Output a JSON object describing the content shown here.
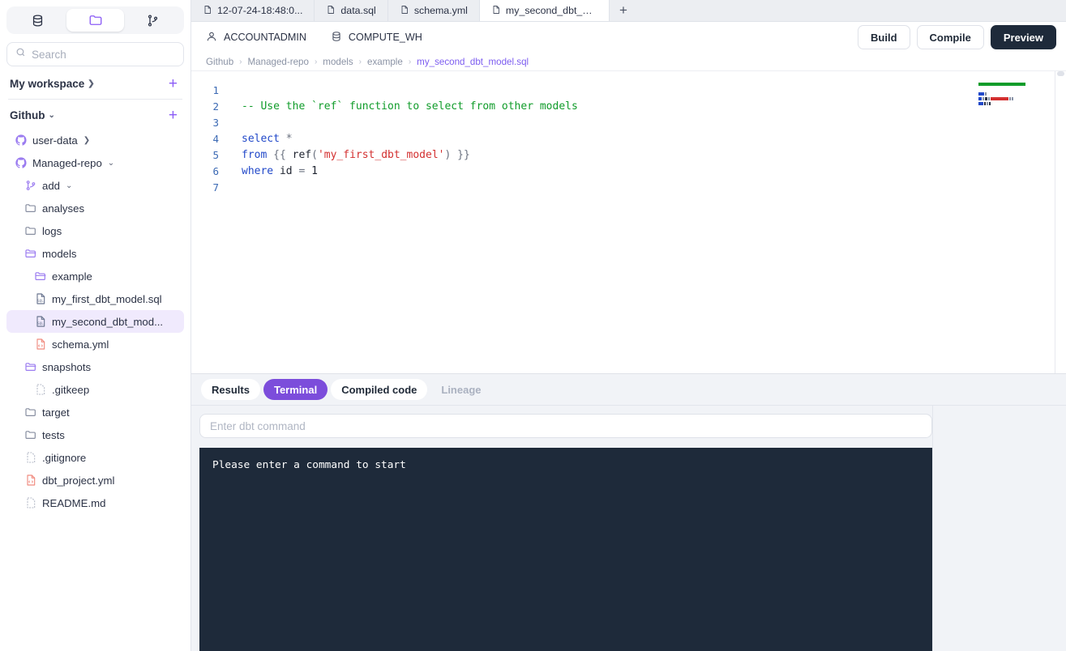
{
  "sidebar": {
    "segments": [
      {
        "name": "database-tab",
        "icon": "database-icon",
        "active": false
      },
      {
        "name": "files-tab",
        "icon": "folder-icon",
        "active": true
      },
      {
        "name": "git-tab",
        "icon": "git-branch-icon",
        "active": false
      }
    ],
    "search": {
      "value": "",
      "placeholder": "Search"
    },
    "sections": [
      {
        "label": "My workspace",
        "chevron": "chevron-right",
        "add": "+"
      },
      {
        "label": "Github",
        "chevron": "chevron-down",
        "add": "+"
      }
    ],
    "tree": [
      {
        "label": "user-data",
        "icon": "github-icon",
        "indent": 1,
        "chevron": "chevron-right",
        "selected": false
      },
      {
        "label": "Managed-repo",
        "icon": "github-icon",
        "indent": 1,
        "chevron": "chevron-down",
        "selected": false
      },
      {
        "label": "add",
        "icon": "branch-icon",
        "indent": 2,
        "chevron": "chevron-down",
        "selected": false
      },
      {
        "label": "analyses",
        "icon": "folder-closed-icon",
        "indent": 2,
        "chevron": "",
        "selected": false
      },
      {
        "label": "logs",
        "icon": "folder-closed-icon",
        "indent": 2,
        "chevron": "",
        "selected": false
      },
      {
        "label": "models",
        "icon": "folder-open-icon",
        "indent": 2,
        "chevron": "",
        "selected": false
      },
      {
        "label": "example",
        "icon": "folder-open-icon",
        "indent": 3,
        "chevron": "",
        "selected": false
      },
      {
        "label": "my_first_dbt_model.sql",
        "icon": "sql-file-icon",
        "indent": 4,
        "chevron": "",
        "selected": false
      },
      {
        "label": "my_second_dbt_mod...",
        "icon": "sql-file-icon",
        "indent": 4,
        "chevron": "",
        "selected": true
      },
      {
        "label": "schema.yml",
        "icon": "yml-file-icon",
        "indent": 4,
        "chevron": "",
        "selected": false
      },
      {
        "label": "snapshots",
        "icon": "folder-open-icon",
        "indent": 2,
        "chevron": "",
        "selected": false
      },
      {
        "label": ".gitkeep",
        "icon": "blank-file-icon",
        "indent": 3,
        "chevron": "",
        "selected": false
      },
      {
        "label": "target",
        "icon": "folder-closed-icon",
        "indent": 2,
        "chevron": "",
        "selected": false
      },
      {
        "label": "tests",
        "icon": "folder-closed-icon",
        "indent": 2,
        "chevron": "",
        "selected": false
      },
      {
        "label": ".gitignore",
        "icon": "blank-file-icon",
        "indent": 2,
        "chevron": "",
        "selected": false
      },
      {
        "label": "dbt_project.yml",
        "icon": "yml-file-icon",
        "indent": 2,
        "chevron": "",
        "selected": false
      },
      {
        "label": "README.md",
        "icon": "blank-file-icon",
        "indent": 2,
        "chevron": "",
        "selected": false
      }
    ]
  },
  "tabs": [
    {
      "label": "12-07-24-18:48:0...",
      "active": false
    },
    {
      "label": "data.sql",
      "active": false
    },
    {
      "label": "schema.yml",
      "active": false
    },
    {
      "label": "my_second_dbt_m...",
      "active": true
    }
  ],
  "tab_add_label": "+",
  "toolbar": {
    "role": "ACCOUNTADMIN",
    "warehouse": "COMPUTE_WH",
    "build_label": "Build",
    "compile_label": "Compile",
    "preview_label": "Preview"
  },
  "breadcrumb": {
    "items": [
      "Github",
      "Managed-repo",
      "models",
      "example"
    ],
    "current": "my_second_dbt_model.sql",
    "separator": "›"
  },
  "editor": {
    "lines": [
      {
        "n": "1",
        "tokens": []
      },
      {
        "n": "2",
        "tokens": [
          {
            "t": "-- Use the `ref` function to select from other models",
            "c": "cm"
          }
        ]
      },
      {
        "n": "3",
        "tokens": []
      },
      {
        "n": "4",
        "tokens": [
          {
            "t": "select",
            "c": "k"
          },
          {
            "t": " ",
            "c": "plain"
          },
          {
            "t": "*",
            "c": "op"
          }
        ]
      },
      {
        "n": "5",
        "tokens": [
          {
            "t": "from",
            "c": "k"
          },
          {
            "t": " ",
            "c": "plain"
          },
          {
            "t": "{{",
            "c": "op"
          },
          {
            "t": " ",
            "c": "plain"
          },
          {
            "t": "ref",
            "c": "plain"
          },
          {
            "t": "(",
            "c": "op"
          },
          {
            "t": "'my_first_dbt_model'",
            "c": "st"
          },
          {
            "t": ")",
            "c": "op"
          },
          {
            "t": " ",
            "c": "plain"
          },
          {
            "t": "}}",
            "c": "op"
          }
        ]
      },
      {
        "n": "6",
        "tokens": [
          {
            "t": "where",
            "c": "k"
          },
          {
            "t": " ",
            "c": "plain"
          },
          {
            "t": "id",
            "c": "plain"
          },
          {
            "t": " ",
            "c": "plain"
          },
          {
            "t": "=",
            "c": "op"
          },
          {
            "t": " ",
            "c": "plain"
          },
          {
            "t": "1",
            "c": "num"
          }
        ]
      },
      {
        "n": "7",
        "tokens": []
      }
    ]
  },
  "bottom_panel": {
    "tabs": [
      {
        "label": "Results",
        "state": "normal"
      },
      {
        "label": "Terminal",
        "state": "active"
      },
      {
        "label": "Compiled code",
        "state": "normal"
      },
      {
        "label": "Lineage",
        "state": "disabled"
      }
    ],
    "command": {
      "value": "",
      "placeholder": "Enter dbt command"
    },
    "terminal_text": "Please enter a command to start"
  },
  "colors": {
    "accent_purple": "#7c4ddb",
    "accent_light_purple": "#8b5cf6",
    "selection_bg": "#f0eafd",
    "dark_navy": "#1e2a3a",
    "panel_bg": "#f1f3f7",
    "tabbar_bg": "#eceef2",
    "comment_green": "#109c2a",
    "keyword_blue": "#2148c9",
    "string_red": "#d32f2f",
    "linenum_blue": "#3c6ab4"
  }
}
